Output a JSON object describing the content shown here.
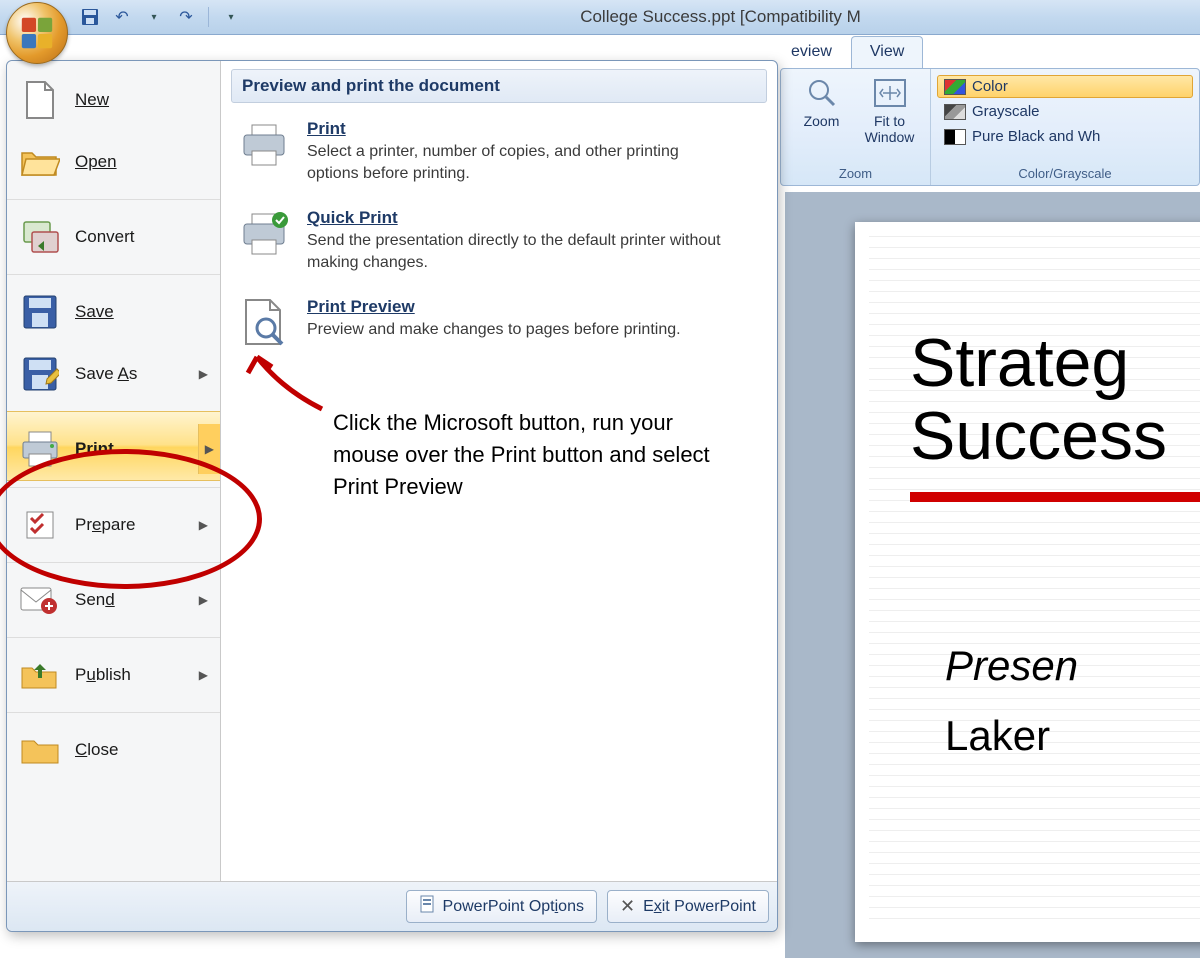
{
  "title": "College Success.ppt [Compatibility M",
  "tabs": {
    "prev": "eview",
    "view": "View"
  },
  "zoom_group": {
    "zoom": "Zoom",
    "fit1": "Fit to",
    "fit2": "Window",
    "label": "Zoom"
  },
  "color_group": {
    "color": "Color",
    "gray": "Grayscale",
    "bw": "Pure Black and Wh",
    "label": "Color/Grayscale"
  },
  "menu": {
    "new": "New",
    "open": "Open",
    "convert": "Convert",
    "save": "Save",
    "saveas": "Save As",
    "print": "Print",
    "prepare": "Prepare",
    "send": "Send",
    "publish": "Publish",
    "close": "Close"
  },
  "sub": {
    "header": "Preview and print the document",
    "print_t": "Print",
    "print_d": "Select a printer, number of copies, and other printing options before printing.",
    "quick_t": "Quick Print",
    "quick_d": "Send the presentation directly to the default printer without making changes.",
    "prev_t": "Print Preview",
    "prev_d": "Preview and make changes to pages before printing."
  },
  "footer": {
    "opts": "PowerPoint Options",
    "exit": "Exit PowerPoint"
  },
  "annot": "Click the Microsoft button, run your mouse over the Print button and select Print Preview",
  "slide": {
    "h1": "Strateg",
    "h2": "Success",
    "pres": "Presen",
    "lake": "Laker"
  }
}
